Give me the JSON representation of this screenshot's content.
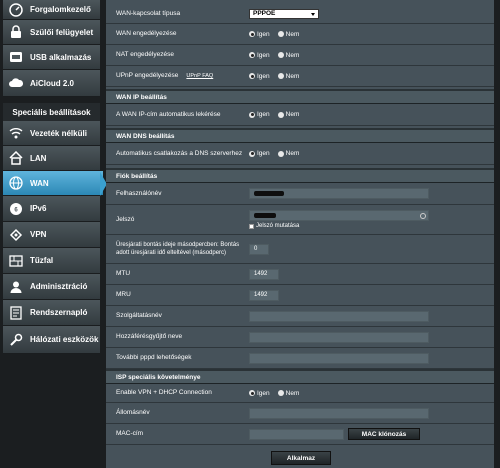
{
  "sidebar": {
    "top_items": [
      {
        "label": "Forgalomkezelő",
        "icon": "traffic-meter-icon"
      },
      {
        "label": "Szülői felügyelet",
        "icon": "lock-icon"
      },
      {
        "label": "USB alkalmazás",
        "icon": "usb-app-icon"
      },
      {
        "label": "AiCloud 2.0",
        "icon": "cloud-icon"
      }
    ],
    "advanced_header": "Speciális beállítások",
    "items": [
      {
        "label": "Vezeték nélküli",
        "icon": "wireless-icon"
      },
      {
        "label": "LAN",
        "icon": "home-icon"
      },
      {
        "label": "WAN",
        "icon": "globe-icon"
      },
      {
        "label": "IPv6",
        "icon": "ipv6-icon"
      },
      {
        "label": "VPN",
        "icon": "vpn-icon"
      },
      {
        "label": "Tűzfal",
        "icon": "firewall-icon"
      },
      {
        "label": "Adminisztráció",
        "icon": "admin-icon"
      },
      {
        "label": "Rendszernapló",
        "icon": "log-icon"
      },
      {
        "label": "Hálózati eszközök",
        "icon": "network-tools-icon"
      }
    ],
    "active": "WAN"
  },
  "basic": {
    "wan_type_label": "WAN-kapcsolat típusa",
    "wan_type_value": "PPPOE",
    "wan_enable_label": "WAN engedélyezése",
    "nat_enable_label": "NAT engedélyezése",
    "upnp_enable_label": "UPnP engedélyezése",
    "upnp_faq": "UPnP  FAQ",
    "yes": "Igen",
    "no": "Nem"
  },
  "wan_ip": {
    "header": "WAN IP beállítás",
    "auto_label": "A WAN IP-cím automatikus lekérése"
  },
  "wan_dns": {
    "header": "WAN DNS beállítás",
    "auto_label": "Automatikus csatlakozás a DNS szerverhez"
  },
  "account": {
    "header": "Fiók beállítás",
    "username_label": "Felhasználónév",
    "password_label": "Jelszó",
    "show_password": "Jelszó mutatása",
    "idle_label": "Üresjárati bontás ideje másodpercben: Bontás adott üresjárati idő elteltével (másodperc)",
    "idle_value": "0",
    "mtu_label": "MTU",
    "mtu_value": "1492",
    "mru_label": "MRU",
    "mru_value": "1492",
    "service_label": "Szolgáltatásnév",
    "ac_label": "Hozzáférésgyűjtő neve",
    "pppd_label": "További pppd lehetőségek"
  },
  "isp": {
    "header": "ISP speciális követelménye",
    "vpn_dhcp_label": "Enable VPN + DHCP Connection",
    "hostname_label": "Állomásnév",
    "mac_label": "MAC-cím",
    "mac_clone": "MAC klónozás"
  },
  "apply": "Alkalmaz"
}
